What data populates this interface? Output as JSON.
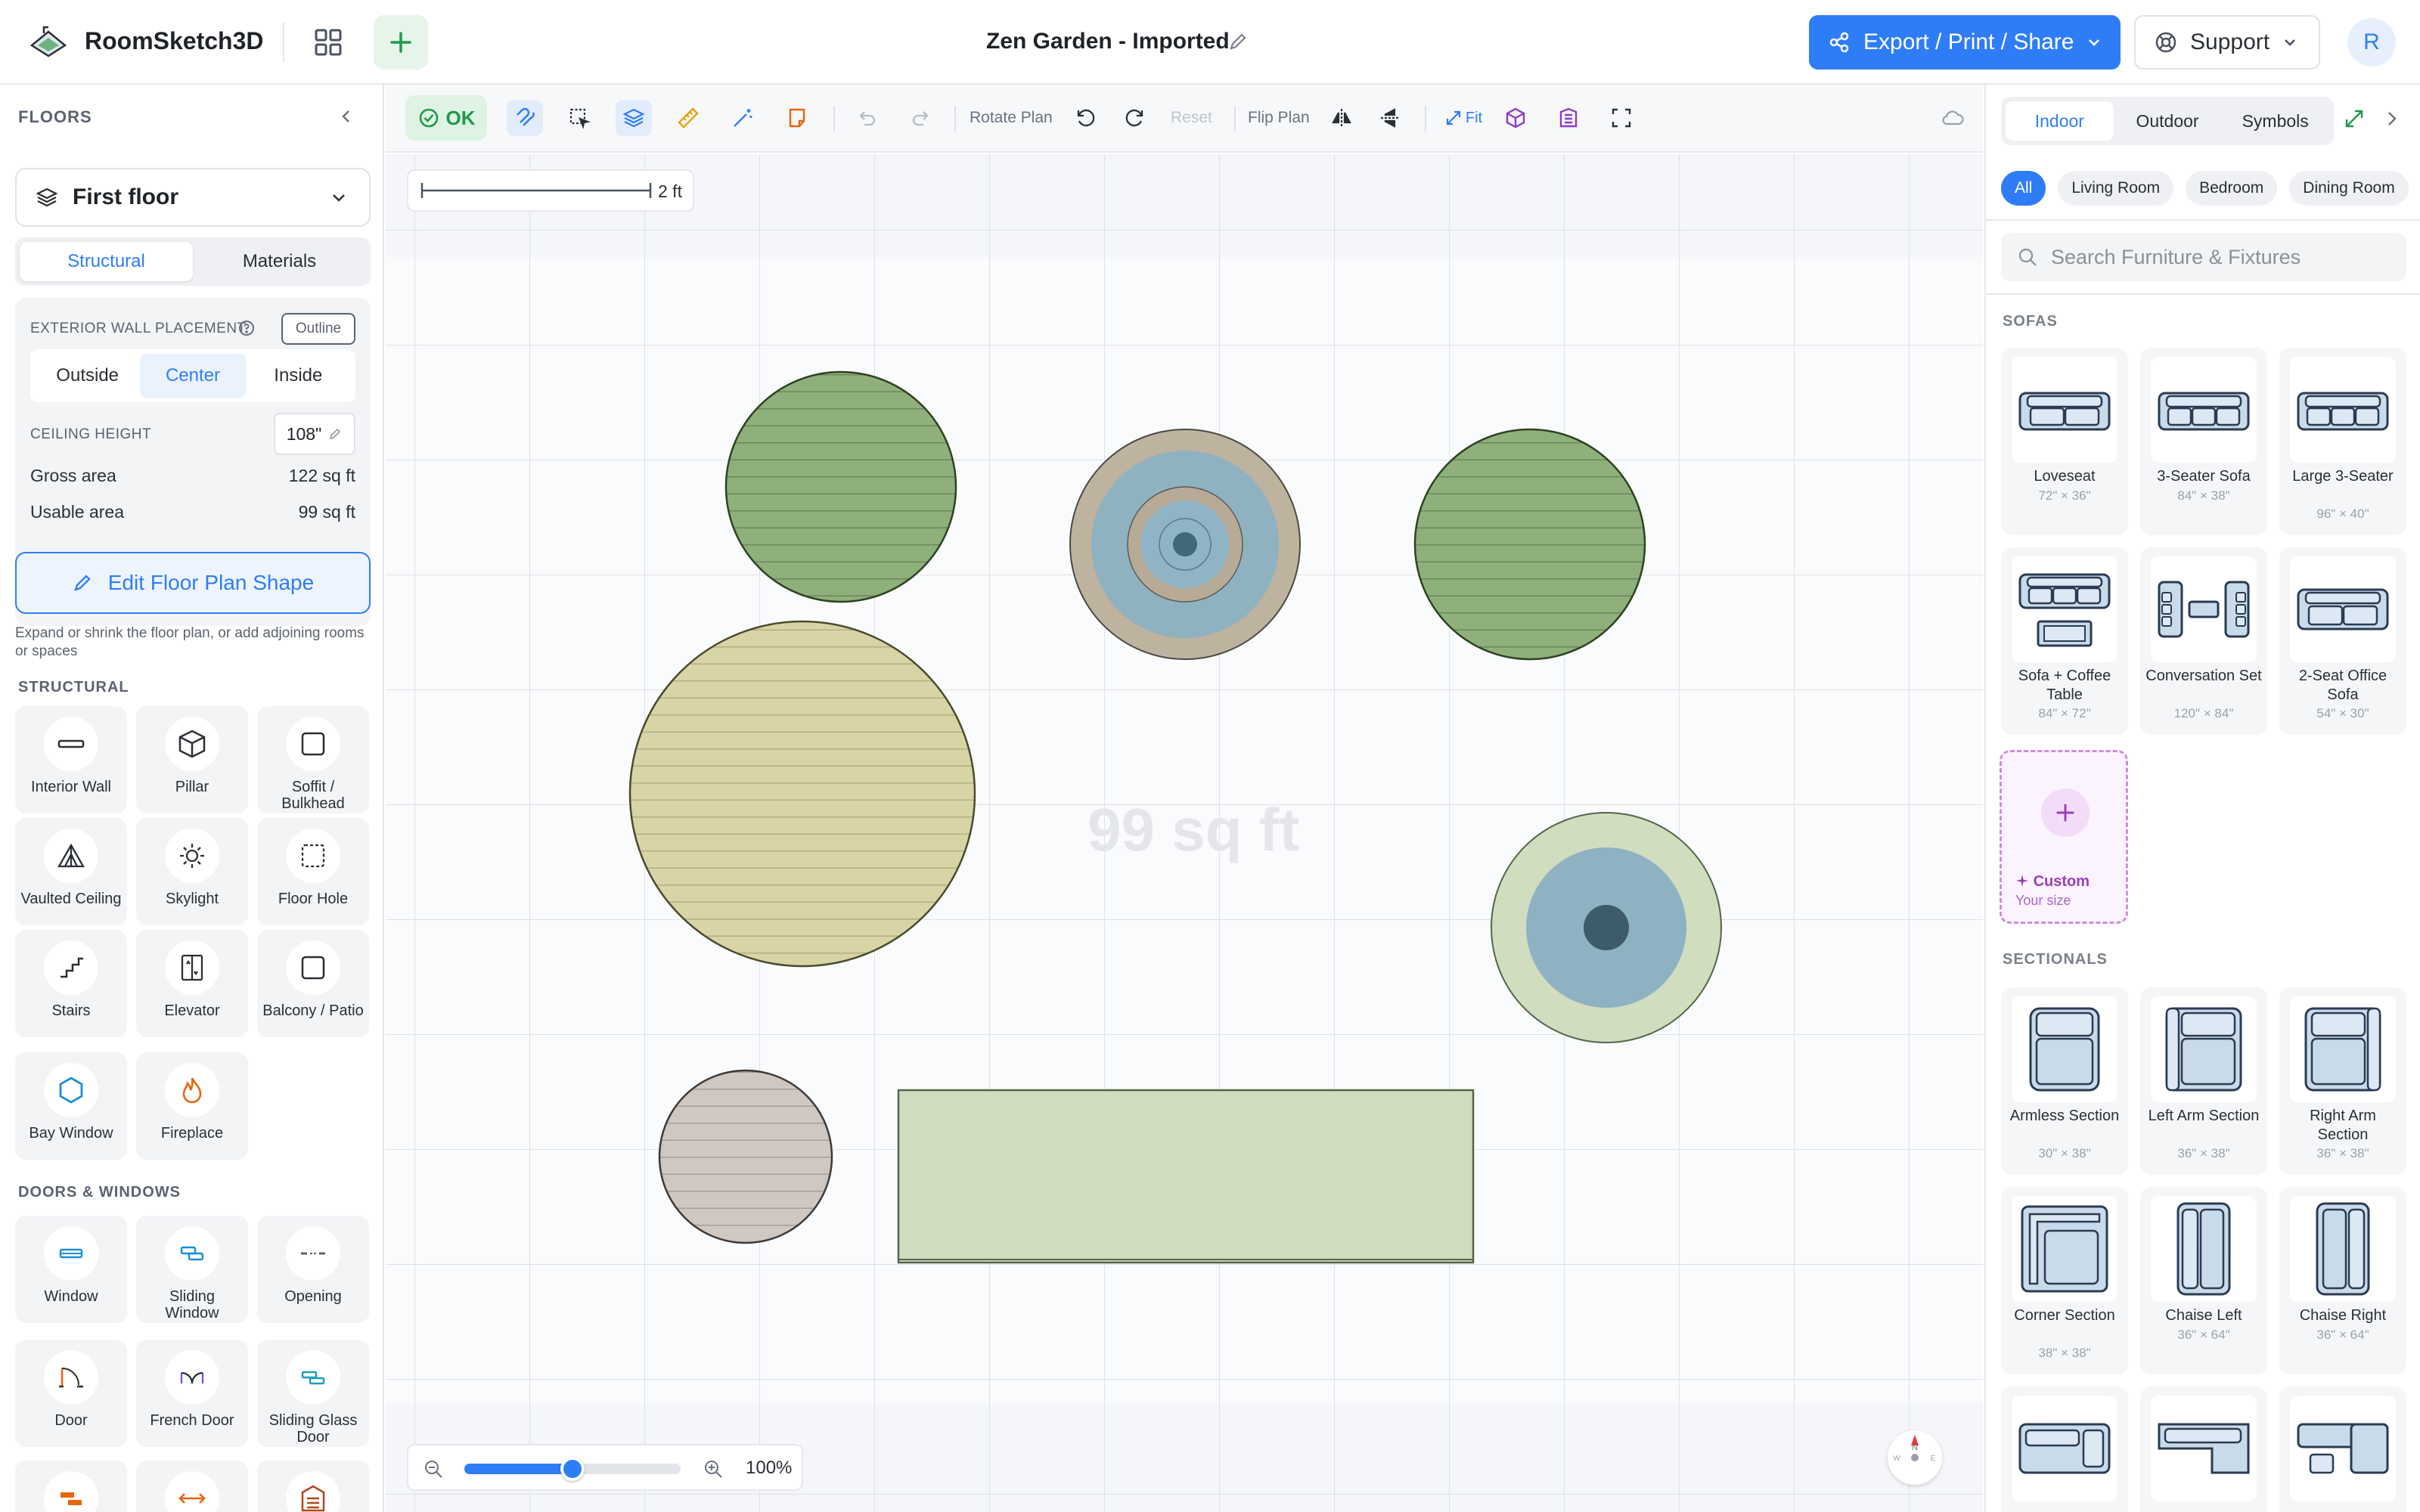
{
  "app": {
    "name": "RoomSketch3D",
    "doc_title": "Zen Garden - Imported"
  },
  "header": {
    "export_label": "Export / Print / Share",
    "support_label": "Support",
    "avatar_initial": "R"
  },
  "left_panel": {
    "heading": "FLOORS",
    "floor_select": "First floor",
    "tabs": [
      "Structural",
      "Materials"
    ],
    "active_tab": "Structural",
    "wall_placement_label": "EXTERIOR WALL PLACEMENT",
    "outline_label": "Outline",
    "placement_options": [
      "Outside",
      "Center",
      "Inside"
    ],
    "active_placement": "Center",
    "ceiling_label": "CEILING HEIGHT",
    "ceiling_value": "108\"",
    "gross_label": "Gross area",
    "gross_value": "122 sq ft",
    "usable_label": "Usable area",
    "usable_value": "99 sq ft",
    "edit_shape_label": "Edit Floor Plan Shape",
    "edit_shape_help": "Expand or shrink the floor plan, or add adjoining rooms or spaces",
    "structural_title": "STRUCTURAL",
    "structural_items": [
      "Interior Wall",
      "Pillar",
      "Soffit / Bulkhead",
      "Vaulted Ceiling",
      "Skylight",
      "Floor Hole",
      "Stairs",
      "Elevator",
      "Balcony / Patio",
      "Bay Window",
      "Fireplace"
    ],
    "doors_title": "DOORS & WINDOWS",
    "door_items": [
      "Window",
      "Sliding Window",
      "Opening",
      "Door",
      "French Door",
      "Sliding Glass Door"
    ]
  },
  "toolbar": {
    "ok_label": "OK",
    "rotate_label": "Rotate Plan",
    "reset_label": "Reset",
    "flip_label": "Flip Plan",
    "fit_label": "Fit"
  },
  "canvas": {
    "scale_label": "2 ft",
    "area_label": "99 sq ft",
    "zoom_label": "100%",
    "zoom_level": 0.5,
    "compass_n": "N",
    "compass_w": "W",
    "compass_e": "E"
  },
  "right_panel": {
    "tabs": [
      "Indoor",
      "Outdoor",
      "Symbols"
    ],
    "active_tab": "Indoor",
    "filters": [
      "All",
      "Living Room",
      "Bedroom",
      "Dining Room"
    ],
    "active_filter": "All",
    "search_placeholder": "Search Furniture & Fixtures",
    "sofas_title": "SOFAS",
    "sofas": [
      {
        "name": "Loveseat",
        "size": "72\" × 36\""
      },
      {
        "name": "3-Seater Sofa",
        "size": "84\" × 38\""
      },
      {
        "name": "Large 3-Seater",
        "size": "96\" × 40\""
      },
      {
        "name": "Sofa + Coffee Table",
        "size": "84\" × 72\""
      },
      {
        "name": "Conversation Set",
        "size": "120\" × 84\""
      },
      {
        "name": "2-Seat Office Sofa",
        "size": "54\" × 30\""
      }
    ],
    "custom_label": "Custom",
    "custom_sub": "Your size",
    "sectionals_title": "SECTIONALS",
    "sectionals": [
      {
        "name": "Armless Section",
        "size": "30\" × 38\""
      },
      {
        "name": "Left Arm Section",
        "size": "36\" × 38\""
      },
      {
        "name": "Right Arm Section",
        "size": "36\" × 38\""
      },
      {
        "name": "Corner Section",
        "size": "38\" × 38\""
      },
      {
        "name": "Chaise Left",
        "size": "36\" × 64\""
      },
      {
        "name": "Chaise Right",
        "size": "36\" × 64\""
      }
    ]
  },
  "colors": {
    "accent": "#2f7df6",
    "ok_green": "#1e9a4a",
    "custom_purple": "#9b3fb6"
  }
}
